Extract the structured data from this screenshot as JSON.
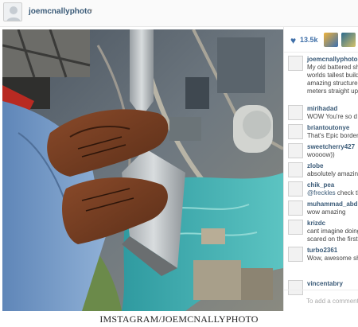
{
  "header": {
    "username": "joemcnallyphoto",
    "caret": "▾"
  },
  "likes": {
    "icon": "heart-icon",
    "count": "13.5k"
  },
  "comments": [
    {
      "user": "joemcnallyphoto",
      "lines": [
        "My old battered sh",
        "worlds tallest build",
        "amazing structure",
        "meters straight up"
      ]
    },
    {
      "user": "mirihadad",
      "lines": [
        "WOW You're so d"
      ]
    },
    {
      "user": "briantoutonye",
      "lines": [
        "That's Epic border"
      ]
    },
    {
      "user": "sweetcherry427",
      "lines": [
        "woooow))"
      ]
    },
    {
      "user": "zlobe",
      "lines": [
        "absolutely amazing"
      ]
    },
    {
      "user": "chik_pea",
      "mention": "@freckles",
      "lines": [
        " check th"
      ]
    },
    {
      "user": "muhammad_abd",
      "lines": [
        "wow amazing"
      ]
    },
    {
      "user": "krizdc",
      "lines": [
        "cant imagine doing",
        "scared on the first"
      ]
    },
    {
      "user": "turbo2361",
      "lines": [
        "Wow, awesome sh"
      ]
    },
    {
      "user": "vincentabry",
      "lines": []
    }
  ],
  "add_comment": {
    "placeholder": "To add a comment"
  },
  "caption": "IMSTAGRAM/JOEMCNALLYPHOTO"
}
